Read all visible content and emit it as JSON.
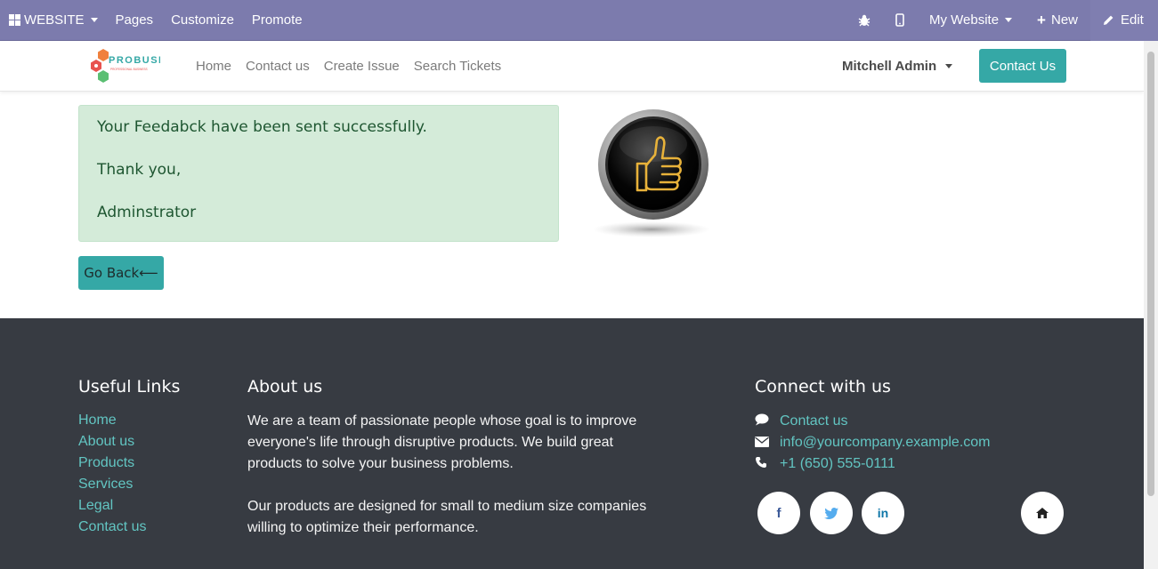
{
  "admin_bar": {
    "website": "WEBSITE",
    "pages": "Pages",
    "customize": "Customize",
    "promote": "Promote",
    "my_website": "My Website",
    "new": "New",
    "edit": "Edit",
    "bar_color": "#7c7bad"
  },
  "header": {
    "logo_text": "PROBUSE",
    "logo_subtext": "PROFESSIONAL BUSINESS",
    "nav": [
      "Home",
      "Contact us",
      "Create Issue",
      "Search Tickets"
    ],
    "user": "Mitchell Admin",
    "contact_button": "Contact Us"
  },
  "main": {
    "alert_lines": [
      "Your Feedabck have been sent successfully.",
      "Thank you,",
      "Adminstrator"
    ],
    "go_back": "Go Back⟵",
    "accent": "#35a8a6"
  },
  "footer": {
    "useful_links_title": "Useful Links",
    "useful_links": [
      "Home",
      "About us",
      "Products",
      "Services",
      "Legal",
      "Contact us"
    ],
    "about_title": "About us",
    "about_p1": "We are a team of passionate people whose goal is to improve everyone's life through disruptive products. We build great products to solve your business problems.",
    "about_p2": "Our products are designed for small to medium size companies willing to optimize their performance.",
    "connect_title": "Connect with us",
    "connect": {
      "contact": "Contact us",
      "email": "info@yourcompany.example.com",
      "phone": "+1 (650) 555-0111"
    },
    "social": {
      "facebook": "f",
      "linkedin": "in"
    },
    "background": "#373b42",
    "link_color": "#62c5c2"
  }
}
